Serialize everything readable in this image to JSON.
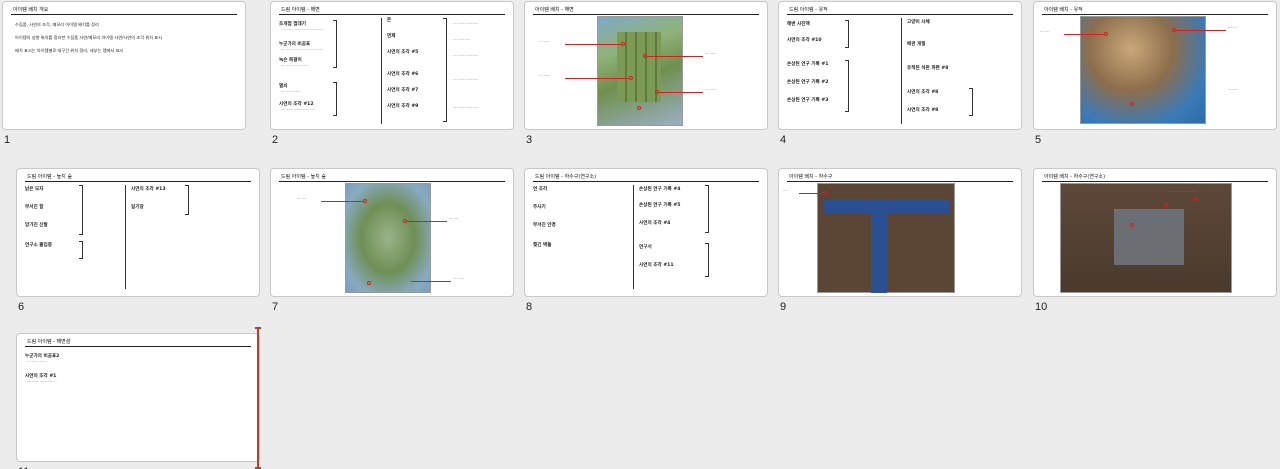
{
  "slides": [
    {
      "number": "1",
      "title": "아이템 배치 개요",
      "lines": [
        "수집품, 사연의 조각, 메모리 아이템 배치를 정리",
        "아이템의 성향 위치를 정리한 수집품 사연/메모리 아이템 사연/사연의 조각 위치 표시",
        "배치 표시는 아이템별로 대구간 위치 정리, 세부는 맵에서 표시"
      ]
    },
    {
      "number": "2",
      "title": "드림 아이템 - 해변",
      "items": [
        "조개껍 껍데기",
        "누군가의 비공표",
        "녹슨 목걸이",
        "열쇠",
        "사연의 조각 #12",
        "돈",
        "면제",
        "사연의 조각 #5",
        "사연의 조각 #6",
        "사연의 조각 #7",
        "사연의 조각 #9"
      ]
    },
    {
      "number": "3",
      "title": "아이템 배치 - 해변"
    },
    {
      "number": "4",
      "title": "드림 아이템 - 유적",
      "items": [
        "해변 사진액",
        "사연의 조각 #10",
        "손상된 연구 기록 #1",
        "손상된 연구 기록 #2",
        "손상된 연구 기록 #3",
        "고양이 사체",
        "배관 개질",
        "유적된 석판 파편 #8",
        "사연의 조각 #8",
        "사연의 조각 #8"
      ]
    },
    {
      "number": "5",
      "title": "아이템 배치 - 유적"
    },
    {
      "number": "6",
      "title": "드림 아이템 - 늪지 숲",
      "items": [
        "낡은 모자",
        "부서진 함",
        "망가진 신발",
        "연구소 출입증",
        "사연의 조각 #13",
        "일기장"
      ]
    },
    {
      "number": "7",
      "title": "드림 아이템 - 늪지 숲"
    },
    {
      "number": "8",
      "title": "드림 아이템 - 하수구(연구소)",
      "items": [
        "연 조각",
        "주사기",
        "부서진 안경",
        "찢긴 벽돌",
        "손상된 연구 기록 #4",
        "손상된 연구 기록 #5",
        "사연의 조각 #4",
        "연구서",
        "사연의 조각 #11"
      ]
    },
    {
      "number": "9",
      "title": "아이템 배치 - 하수구"
    },
    {
      "number": "10",
      "title": "아이템 배치 - 하수구(연구소)"
    },
    {
      "number": "11",
      "title": "드림 아이템 - 해변섬",
      "items": [
        "누군가의 비공표2",
        "사연의 조각 #1"
      ]
    }
  ],
  "colors": {
    "background": "#ececec",
    "slide": "#ffffff",
    "accent": "#d42020",
    "drop_marker": "#c0392b"
  }
}
